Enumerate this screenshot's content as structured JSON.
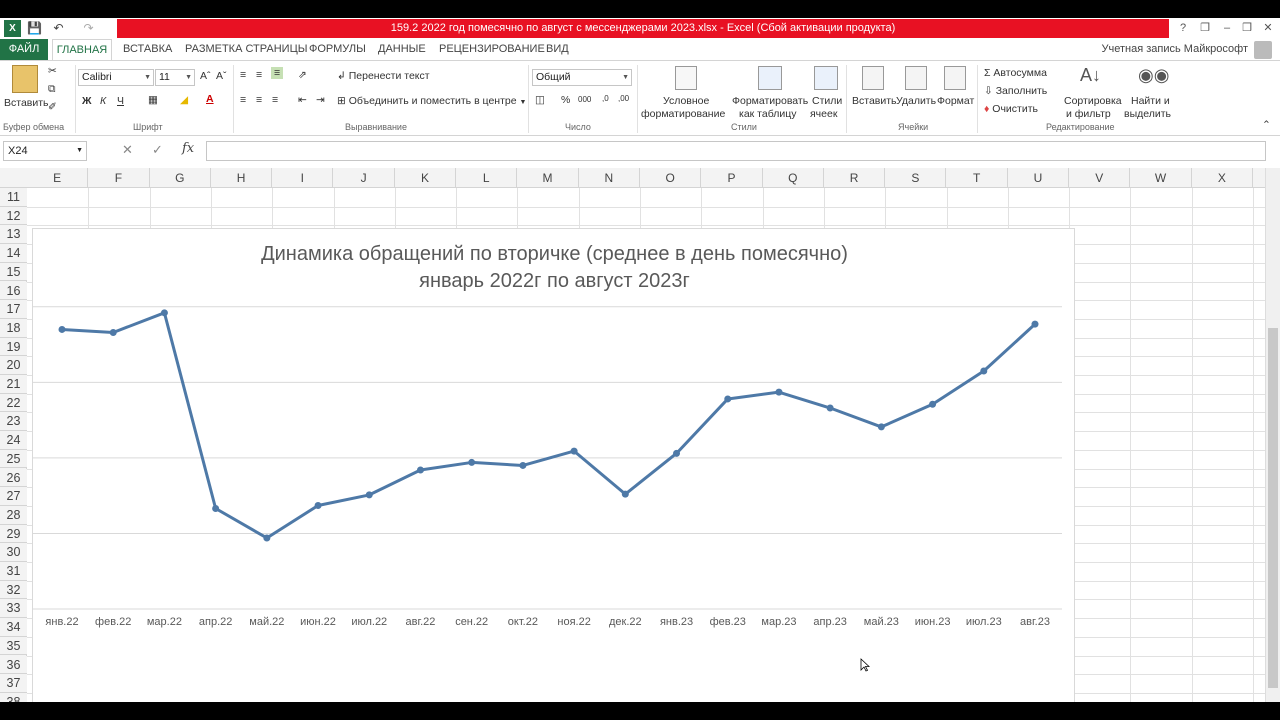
{
  "titlebar": {
    "title": "159.2 2022 год помесячно по август с мессенджерами 2023.xlsx -  Excel (Сбой активации продукта)",
    "help": "?",
    "window_buttons": [
      "❐",
      "–",
      "❒",
      "✕"
    ]
  },
  "tabs": {
    "file": "ФАЙЛ",
    "items": [
      "ГЛАВНАЯ",
      "ВСТАВКА",
      "РАЗМЕТКА СТРАНИЦЫ",
      "ФОРМУЛЫ",
      "ДАННЫЕ",
      "РЕЦЕНЗИРОВАНИЕ",
      "ВИД"
    ],
    "account": "Учетная запись Майкрософт"
  },
  "ribbon": {
    "paste": "Вставить",
    "clipboard_label": "Буфер обмена",
    "font_name": "Calibri",
    "font_size": "11",
    "bold": "Ж",
    "italic": "К",
    "underline": "Ч",
    "font_label": "Шрифт",
    "wrap_text": "Перенести текст",
    "merge_center": "Объединить и поместить в центре",
    "alignment_label": "Выравнивание",
    "number_format": "Общий",
    "number_label": "Число",
    "cond_format_1": "Условное",
    "cond_format_2": "форматирование",
    "format_table_1": "Форматировать",
    "format_table_2": "как таблицу",
    "cell_styles_1": "Стили",
    "cell_styles_2": "ячеек",
    "styles_label": "Стили",
    "insert": "Вставить",
    "delete": "Удалить",
    "format": "Формат",
    "cells_label": "Ячейки",
    "autosum": "Автосумма",
    "fill": "Заполнить",
    "clear": "Очистить",
    "sort_filter_1": "Сортировка",
    "sort_filter_2": "и фильтр",
    "find_select_1": "Найти и",
    "find_select_2": "выделить",
    "editing_label": "Редактирование"
  },
  "formula_bar": {
    "name_box": "X24",
    "fx": "fx",
    "value": ""
  },
  "grid": {
    "columns": [
      "E",
      "F",
      "G",
      "H",
      "I",
      "J",
      "K",
      "L",
      "M",
      "N",
      "O",
      "P",
      "Q",
      "R",
      "S",
      "T",
      "U",
      "V",
      "W",
      "X"
    ],
    "rows": [
      "11",
      "12",
      "13",
      "14",
      "15",
      "16",
      "17",
      "18",
      "19",
      "20",
      "21",
      "22",
      "23",
      "24",
      "25",
      "26",
      "27",
      "28",
      "29",
      "30",
      "31",
      "32",
      "33",
      "34",
      "35",
      "36",
      "37",
      "38"
    ]
  },
  "chart_data": {
    "type": "line",
    "title_line1": "Динамика обращений по вторичке (среднее в день помесячно)",
    "title_line2": "январь 2022г по август 2023г",
    "categories": [
      "янв.22",
      "фев.22",
      "мар.22",
      "апр.22",
      "май.22",
      "июн.22",
      "июл.22",
      "авг.22",
      "сен.22",
      "окт.22",
      "ноя.22",
      "дек.22",
      "янв.23",
      "фев.23",
      "мар.23",
      "апр.23",
      "май.23",
      "июн.23",
      "июл.23",
      "авг.23"
    ],
    "values": [
      370,
      366,
      392,
      133,
      94,
      137,
      151,
      184,
      194,
      190,
      209,
      152,
      206,
      278,
      287,
      266,
      241,
      271,
      315,
      377
    ],
    "ylim": [
      0,
      450
    ],
    "grid": true,
    "legend": "none",
    "line_color": "#4e79a7"
  }
}
